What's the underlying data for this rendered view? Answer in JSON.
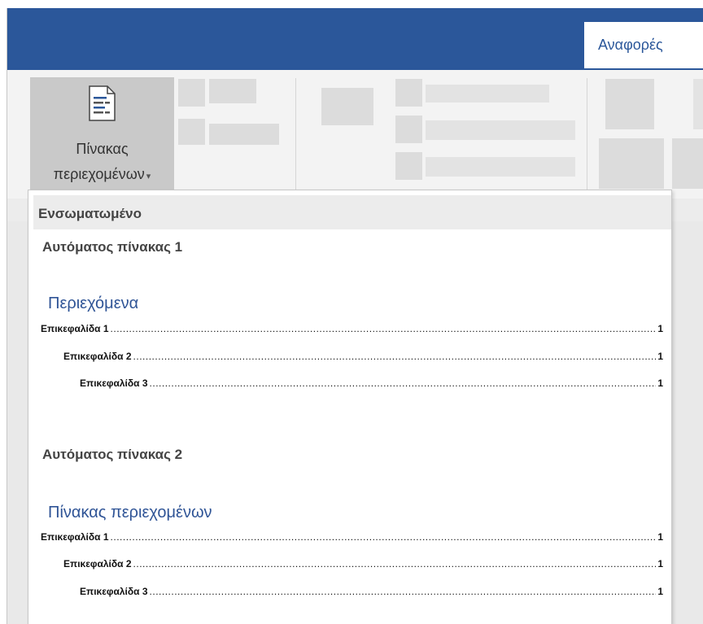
{
  "ribbon": {
    "active_tab": "Αναφορές",
    "toc_button": {
      "line1": "Πίνακας",
      "line2": "περιεχομένων",
      "icon": "document-list-icon"
    }
  },
  "dropdown": {
    "header": "Ενσωματωμένο",
    "items": [
      {
        "title": "Αυτόματος πίνακας 1",
        "heading": "Περιεχόμενα",
        "entries": [
          {
            "text": "Επικεφαλίδα 1",
            "page": "1"
          },
          {
            "text": "Επικεφαλίδα 2",
            "page": "1"
          },
          {
            "text": "Επικεφαλίδα 3",
            "page": "1"
          }
        ]
      },
      {
        "title": "Αυτόματος πίνακας 2",
        "heading": "Πίνακας περιεχομένων",
        "entries": [
          {
            "text": "Επικεφαλίδα 1",
            "page": "1"
          },
          {
            "text": "Επικεφαλίδα 2",
            "page": "1"
          },
          {
            "text": "Επικεφαλίδα 3",
            "page": "1"
          }
        ]
      }
    ]
  }
}
